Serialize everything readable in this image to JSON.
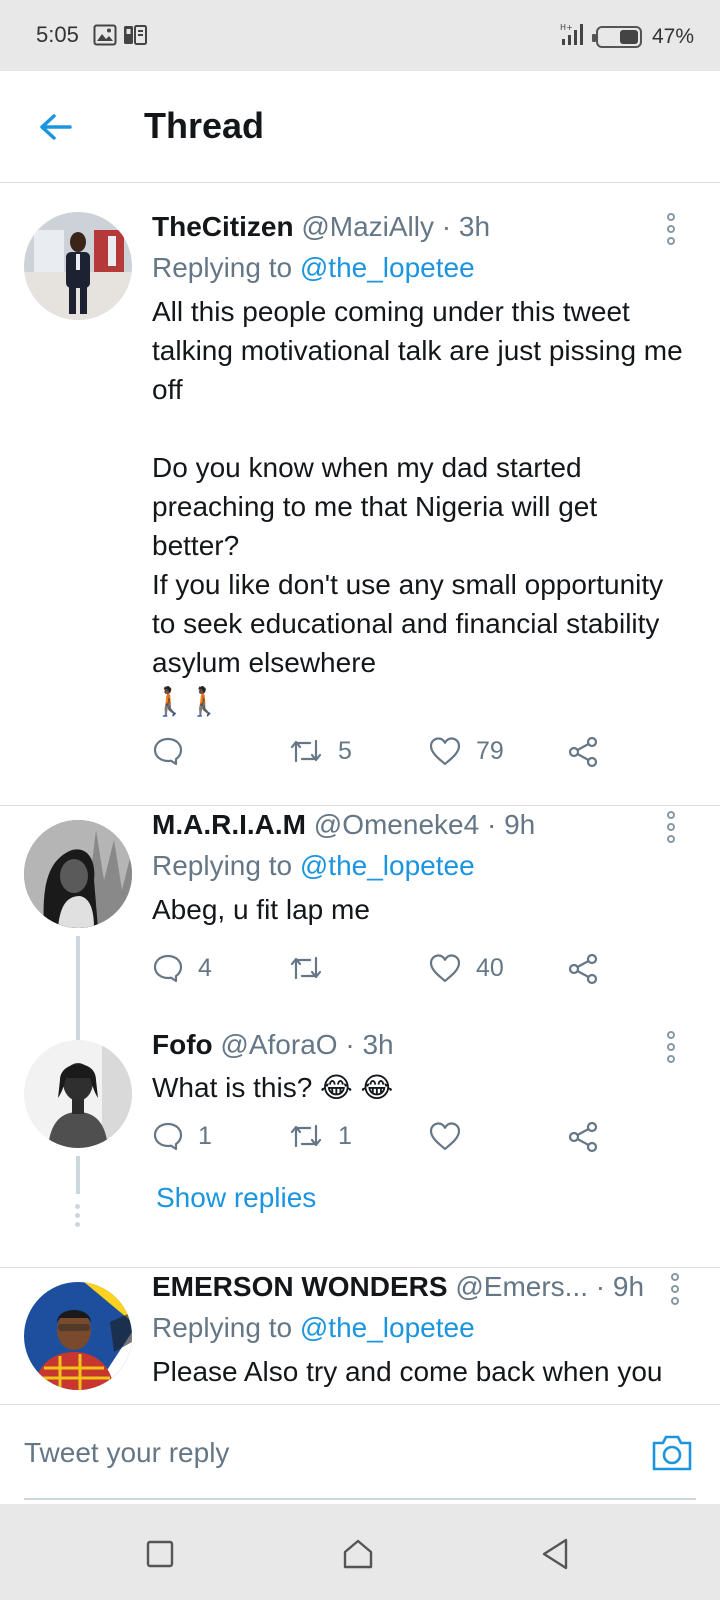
{
  "status_bar": {
    "time": "5:05",
    "battery": "47%",
    "battery_level": 0.47
  },
  "header": {
    "title": "Thread"
  },
  "tweets": [
    {
      "name": "TheCitizen",
      "handle": "@MaziAlly",
      "time": "3h",
      "replying_label": "Replying to",
      "replying_to": "@the_lopetee",
      "text": "All this people coming under this tweet talking motivational talk are just pissing me off\n\nDo you know when my dad started preaching to me that Nigeria will get better?\nIf you like don't use any small opportunity to seek educational and financial stability asylum elsewhere\n🚶🏿🚶🏿",
      "replies": "",
      "retweets": "5",
      "likes": "79"
    },
    {
      "name": "M.A.R.I.A.M",
      "handle": "@Omeneke4",
      "time": "9h",
      "replying_label": "Replying to",
      "replying_to": "@the_lopetee",
      "text": "Abeg, u fit lap me",
      "replies": "4",
      "retweets": "",
      "likes": "40"
    },
    {
      "name": "Fofo",
      "handle": "@AforaO",
      "time": "3h",
      "text": "What is this? 😂 😂",
      "replies": "1",
      "retweets": "1",
      "likes": ""
    },
    {
      "name": "EMERSON WONDERS",
      "handle": "@Emers...",
      "time": "9h",
      "replying_label": "Replying to",
      "replying_to": "@the_lopetee",
      "text": "Please Also try and come back when you"
    }
  ],
  "show_replies": "Show replies",
  "composer": {
    "placeholder": "Tweet your reply"
  },
  "colors": {
    "accent": "#1b95e0",
    "secondary_text": "#657786",
    "divider": "#d9dfe3"
  }
}
